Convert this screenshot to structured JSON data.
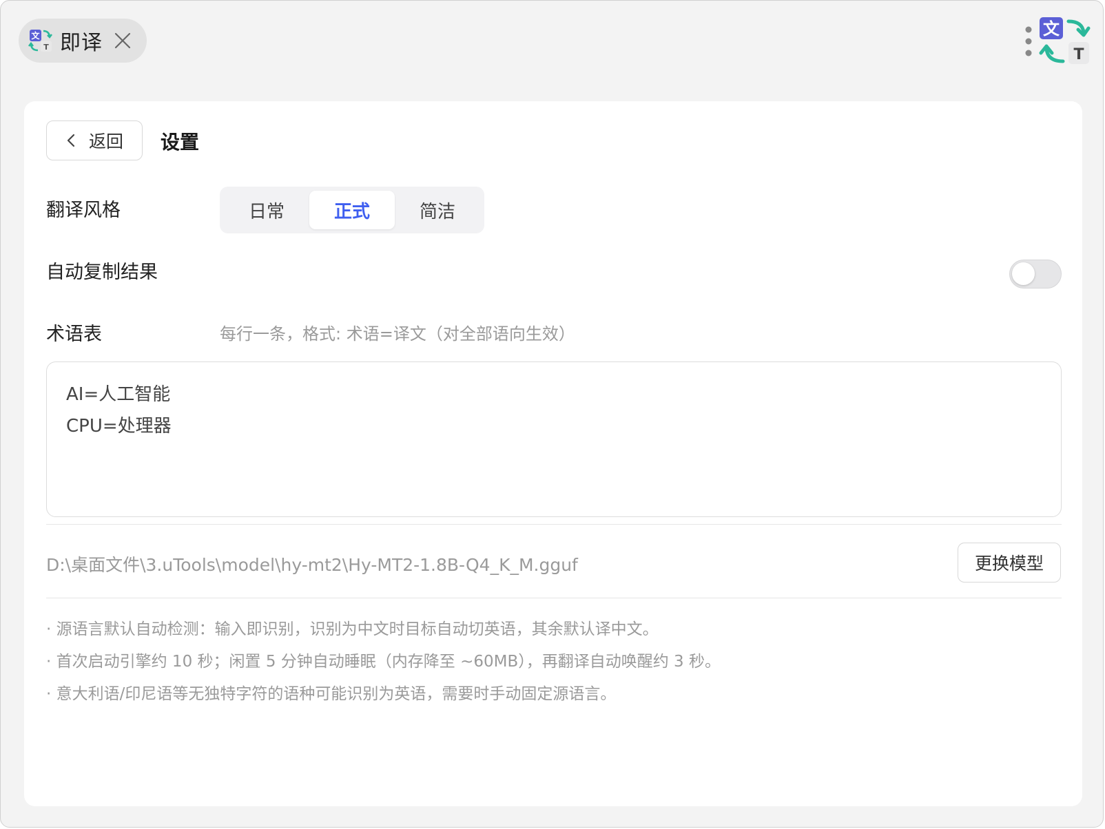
{
  "colors": {
    "accent": "#3f5ff0",
    "logo_purple": "#5b5fd6",
    "logo_teal": "#2bb89a",
    "window_bg": "#f3f3f3",
    "card_bg": "#ffffff"
  },
  "titlebar": {
    "app_name": "即译",
    "logo_icon": "translate-logo-icon",
    "close_icon": "close-icon",
    "more_icon": "more-vertical-icon"
  },
  "header": {
    "back_label": "返回",
    "title": "设置"
  },
  "style_setting": {
    "label": "翻译风格",
    "options": [
      "日常",
      "正式",
      "简洁"
    ],
    "selected": "正式"
  },
  "auto_copy": {
    "label": "自动复制结果",
    "enabled": false
  },
  "glossary": {
    "label": "术语表",
    "hint": "每行一条，格式: 术语=译文（对全部语向生效）",
    "lines": [
      "AI=人工智能",
      "CPU=处理器"
    ]
  },
  "model": {
    "path": "D:\\桌面文件\\3.uTools\\model\\hy-mt2\\Hy-MT2-1.8B-Q4_K_M.gguf",
    "change_label": "更换模型"
  },
  "notes": [
    "· 源语言默认自动检测：输入即识别，识别为中文时目标自动切英语，其余默认译中文。",
    "· 首次启动引擎约 10 秒；闲置 5 分钟自动睡眠（内存降至 ~60MB），再翻译自动唤醒约 3 秒。",
    "· 意大利语/印尼语等无独特字符的语种可能识别为英语，需要时手动固定源语言。"
  ]
}
